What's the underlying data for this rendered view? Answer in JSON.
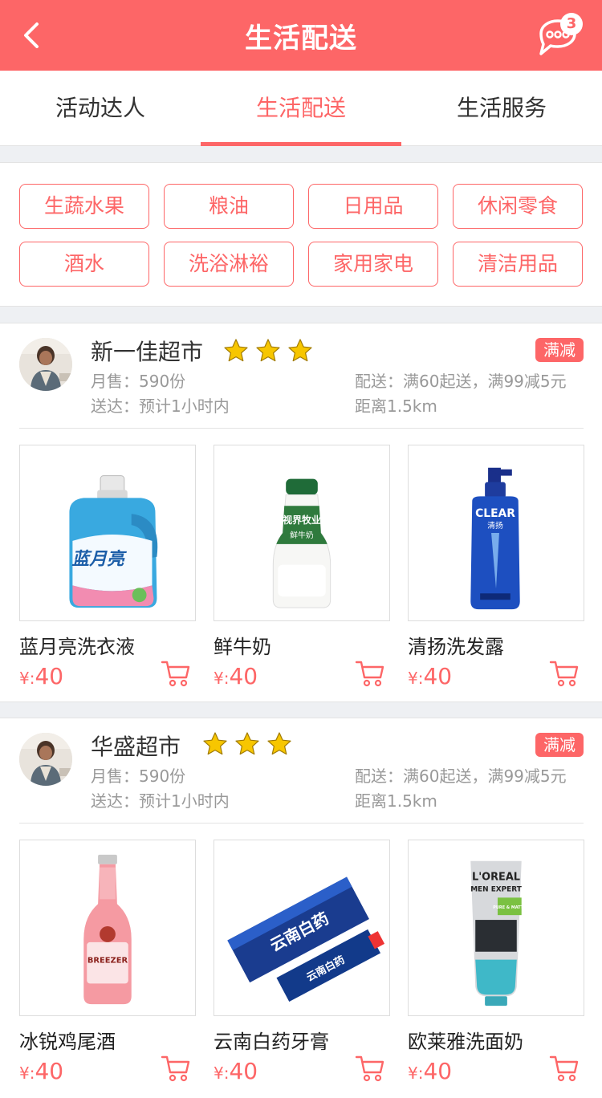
{
  "header": {
    "title": "生活配送",
    "back_icon": "back-chevron-icon",
    "message_icon": "chat-bubble-icon",
    "message_count": "3"
  },
  "tabs": [
    {
      "label": "活动达人",
      "active": false
    },
    {
      "label": "生活配送",
      "active": true
    },
    {
      "label": "生活服务",
      "active": false
    }
  ],
  "categories": [
    "生蔬水果",
    "粮油",
    "日用品",
    "休闲零食",
    "酒水",
    "洗浴淋裕",
    "家用家电",
    "清洁用品"
  ],
  "shops": [
    {
      "name": "新一佳超市",
      "stars": 3,
      "promo_badge": "满减",
      "monthly_sales": "月售：590份",
      "delivery_time": "送达：预计1小时内",
      "delivery_rule": "配送：满60起送，满99减5元",
      "distance": "距离1.5km",
      "products": [
        {
          "name": "蓝月亮洗衣液",
          "currency": "¥:",
          "price": "40"
        },
        {
          "name": "鲜牛奶",
          "currency": "¥:",
          "price": "40"
        },
        {
          "name": "清扬洗发露",
          "currency": "¥:",
          "price": "40"
        }
      ]
    },
    {
      "name": "华盛超市",
      "stars": 3,
      "promo_badge": "满减",
      "monthly_sales": "月售：590份",
      "delivery_time": "送达：预计1小时内",
      "delivery_rule": "配送：满60起送，满99减5元",
      "distance": "距离1.5km",
      "products": [
        {
          "name": "冰锐鸡尾酒",
          "currency": "¥:",
          "price": "40"
        },
        {
          "name": "云南白药牙膏",
          "currency": "¥:",
          "price": "40"
        },
        {
          "name": "欧莱雅洗面奶",
          "currency": "¥:",
          "price": "40"
        }
      ]
    }
  ],
  "product_images": {
    "blue_moon": {
      "logo": "蓝月亮"
    },
    "milk": {
      "brand": "视界牧业",
      "label": "鲜牛奶"
    },
    "clear": {
      "brand": "CLEAR",
      "sub": "清扬"
    },
    "breezer": {
      "brand": "BREEZER"
    },
    "yunnan": {
      "brand": "云南白药"
    },
    "loreal": {
      "brand": "L'OREAL",
      "sub": "MEN EXPERT",
      "tag": "PURE & MATTE"
    }
  },
  "colors": {
    "accent": "#fd6667",
    "star": "#f7c600"
  }
}
